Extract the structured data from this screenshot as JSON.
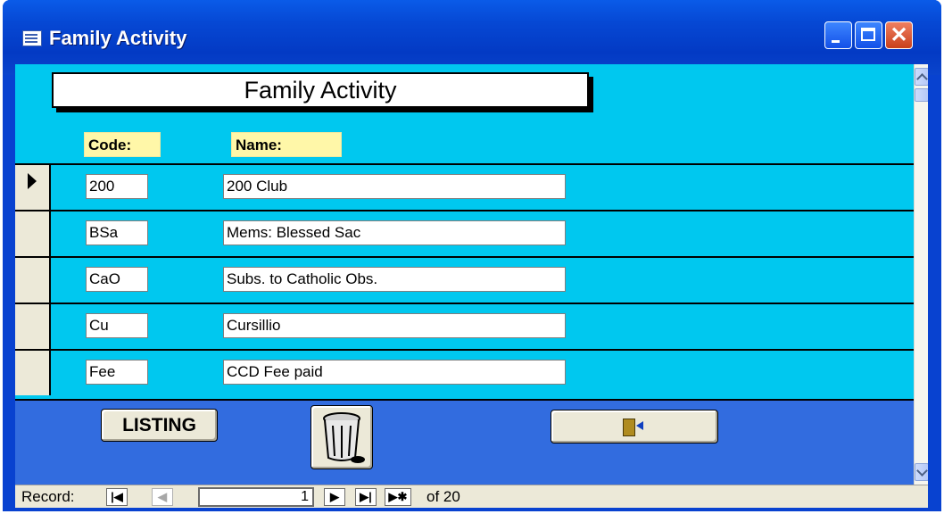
{
  "window": {
    "title": "Family Activity",
    "icons": [
      "form-icon",
      "minimize-icon",
      "maximize-icon",
      "close-icon"
    ],
    "close_glyph": "✕"
  },
  "form": {
    "heading": "Family Activity",
    "code_label": "Code:",
    "name_label": "Name:",
    "rows": [
      {
        "code": "200",
        "name": "200 Club",
        "current": true
      },
      {
        "code": "BSa",
        "name": "Mems: Blessed Sac",
        "current": false
      },
      {
        "code": "CaO",
        "name": "Subs. to Catholic Obs.",
        "current": false
      },
      {
        "code": "Cu",
        "name": "Cursillio",
        "current": false
      },
      {
        "code": "Fee",
        "name": "CCD Fee paid",
        "current": false
      }
    ],
    "listing_label": "LISTING",
    "delete_icon": "trash-can-icon",
    "exit_icon": "exit-door-icon"
  },
  "record_nav": {
    "label": "Record:",
    "first": "|◀",
    "prev": "◀",
    "current": "1",
    "next": "▶",
    "last": "▶|",
    "new": "▶✱",
    "of_text": "of  20"
  },
  "colors": {
    "form_background": "#00c8ef",
    "footer_background": "#326cdf",
    "label_background": "#fff7a8",
    "titlebar": "#0842d0"
  }
}
